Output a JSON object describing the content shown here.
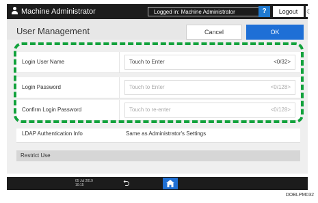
{
  "topbar": {
    "admin_title": "Machine Administrator",
    "logged_in": "Logged in: Machine Administrator",
    "help_label": "?",
    "logout_label": "Logout"
  },
  "header": {
    "title": "User Management",
    "cancel_label": "Cancel",
    "ok_label": "OK"
  },
  "rows": [
    {
      "label": "Login User Name",
      "value": "Touch to Enter",
      "count": "<0/32>"
    },
    {
      "label": "Login Password",
      "value": "Touch to Enter",
      "count": "<0/128>"
    },
    {
      "label": "Confirm Login Password",
      "value": "Touch to re-enter",
      "count": "<0/128>"
    }
  ],
  "ldap": {
    "label": "LDAP Authentication Info",
    "value": "Same as Administrator's Settings"
  },
  "restrict": {
    "label": "Restrict Use"
  },
  "bottombar": {
    "clock_line1": "05 Jul 2019",
    "clock_line2": "10:15"
  },
  "figure_code": "DOBLPM032",
  "colors": {
    "accent": "#1e6fd6",
    "highlight": "#12a23c",
    "bar": "#1c1c1c"
  }
}
